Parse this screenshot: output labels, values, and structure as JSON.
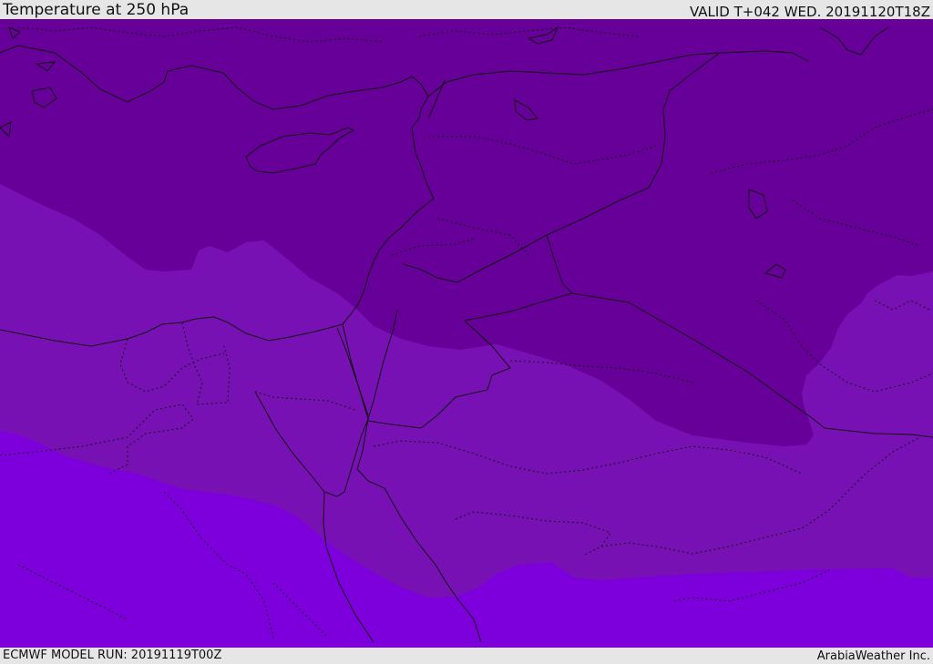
{
  "header": {
    "title": "Temperature at 250 hPa",
    "valid_time": "VALID T+042 WED. 20191120T18Z"
  },
  "footer": {
    "model_run": "ECMWF MODEL RUN: 20191119T00Z",
    "provider": "ArabiaWeather Inc."
  },
  "map": {
    "level_hpa": 250,
    "lead_time_hours": 42,
    "colors": {
      "coldest_band": "#660099",
      "middle_band": "#7711b4",
      "warmest_band": "#7d00dc",
      "boundary_line": "#111111"
    }
  }
}
